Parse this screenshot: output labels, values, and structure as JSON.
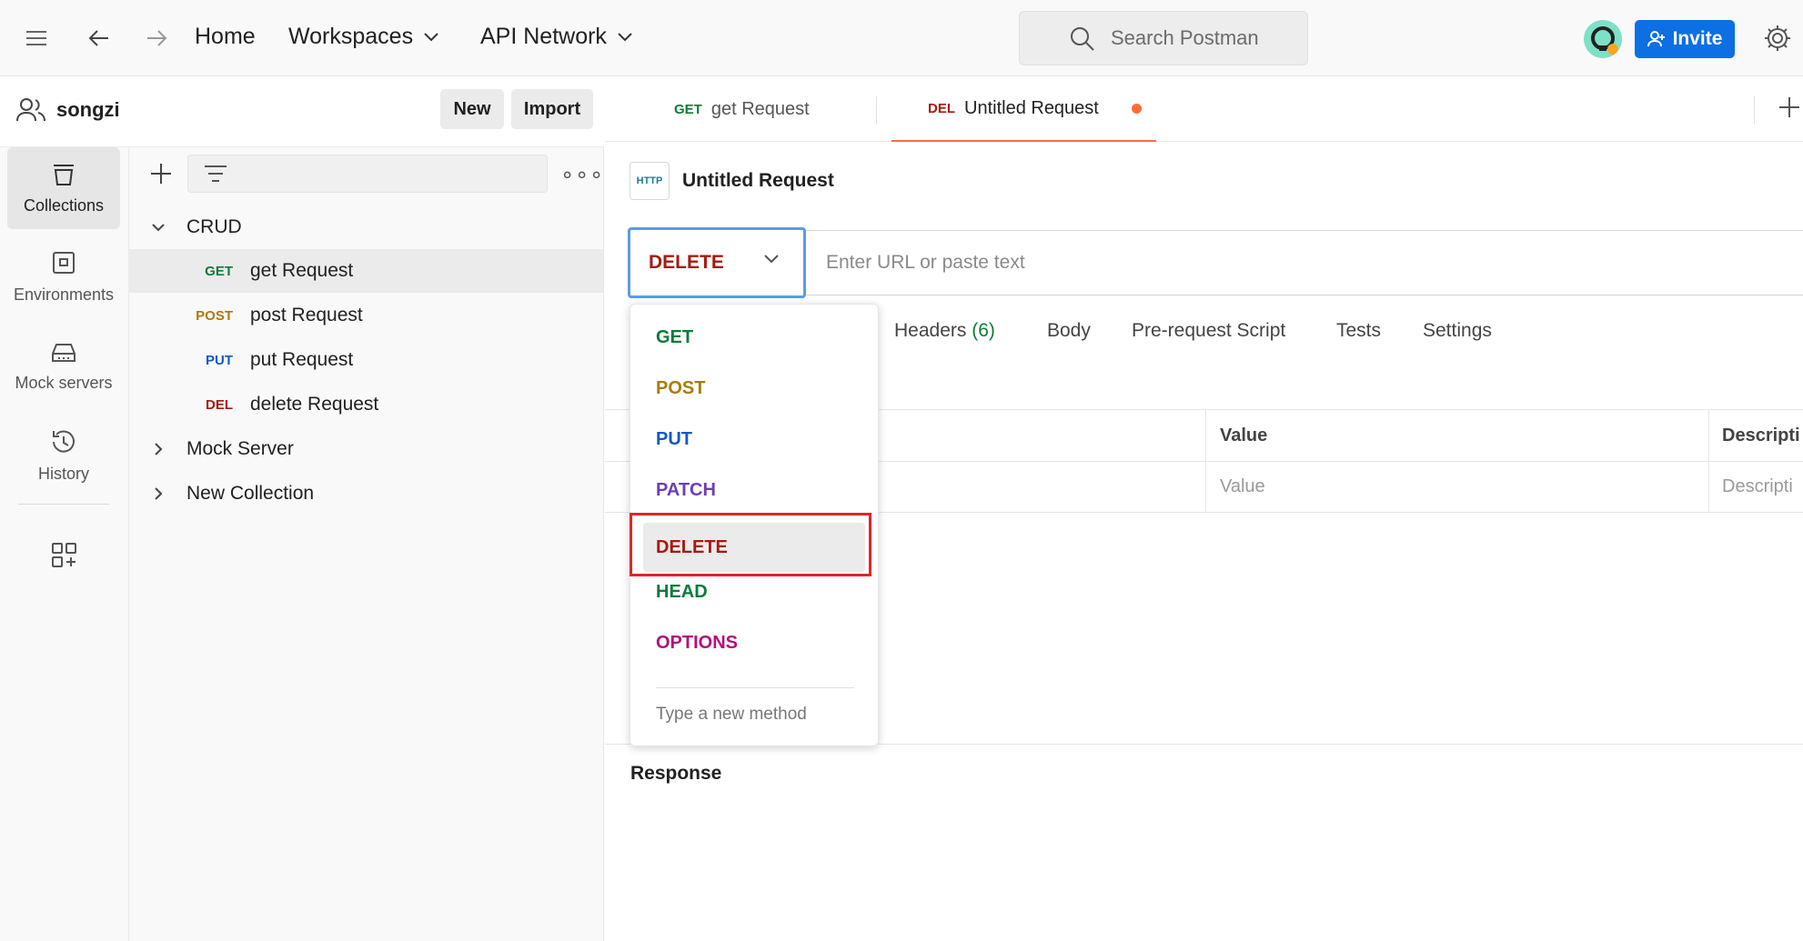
{
  "header": {
    "nav": {
      "home": "Home",
      "workspaces": "Workspaces",
      "api_network": "API Network"
    },
    "search_placeholder": "Search Postman",
    "invite_label": "Invite"
  },
  "workspace": {
    "name": "songzi",
    "new_label": "New",
    "import_label": "Import"
  },
  "rail": [
    {
      "label": "Collections",
      "icon": "collections-icon"
    },
    {
      "label": "Environments",
      "icon": "environments-icon"
    },
    {
      "label": "Mock servers",
      "icon": "mock-servers-icon"
    },
    {
      "label": "History",
      "icon": "history-icon"
    }
  ],
  "tree": {
    "folders": [
      {
        "name": "CRUD",
        "expanded": true,
        "requests": [
          {
            "method": "GET",
            "name": "get Request"
          },
          {
            "method": "POST",
            "name": "post Request"
          },
          {
            "method": "PUT",
            "name": "put Request"
          },
          {
            "method": "DEL",
            "name": "delete Request"
          }
        ]
      },
      {
        "name": "Mock Server",
        "expanded": false
      },
      {
        "name": "New Collection",
        "expanded": false
      }
    ]
  },
  "tabs": [
    {
      "method": "GET",
      "label": "get Request"
    },
    {
      "method": "DEL",
      "label": "Untitled Request",
      "unsaved": true
    }
  ],
  "request": {
    "title": "Untitled Request",
    "http_badge": "HTTP",
    "method": "DELETE",
    "url_placeholder": "Enter URL or paste text",
    "subtabs": {
      "headers": "Headers",
      "headers_count": "(6)",
      "body": "Body",
      "prerequest": "Pre-request Script",
      "tests": "Tests",
      "settings": "Settings"
    },
    "table": {
      "col_value": "Value",
      "col_description": "Descripti",
      "placeholder_value": "Value",
      "placeholder_description": "Descripti"
    },
    "response_label": "Response"
  },
  "dropdown": {
    "options": [
      "GET",
      "POST",
      "PUT",
      "PATCH",
      "DELETE",
      "HEAD",
      "OPTIONS"
    ],
    "selected": "DELETE",
    "new_method_placeholder": "Type a new method"
  },
  "colors": {
    "accent": "#ff6c37",
    "invite_bg": "#0c6fe3",
    "get": "#0d7a3a",
    "post": "#ab7b0a",
    "put": "#1159c7",
    "delete": "#a61b0f",
    "patch": "#6b3fb5",
    "options": "#b0127a",
    "highlight": "#e3242b"
  }
}
